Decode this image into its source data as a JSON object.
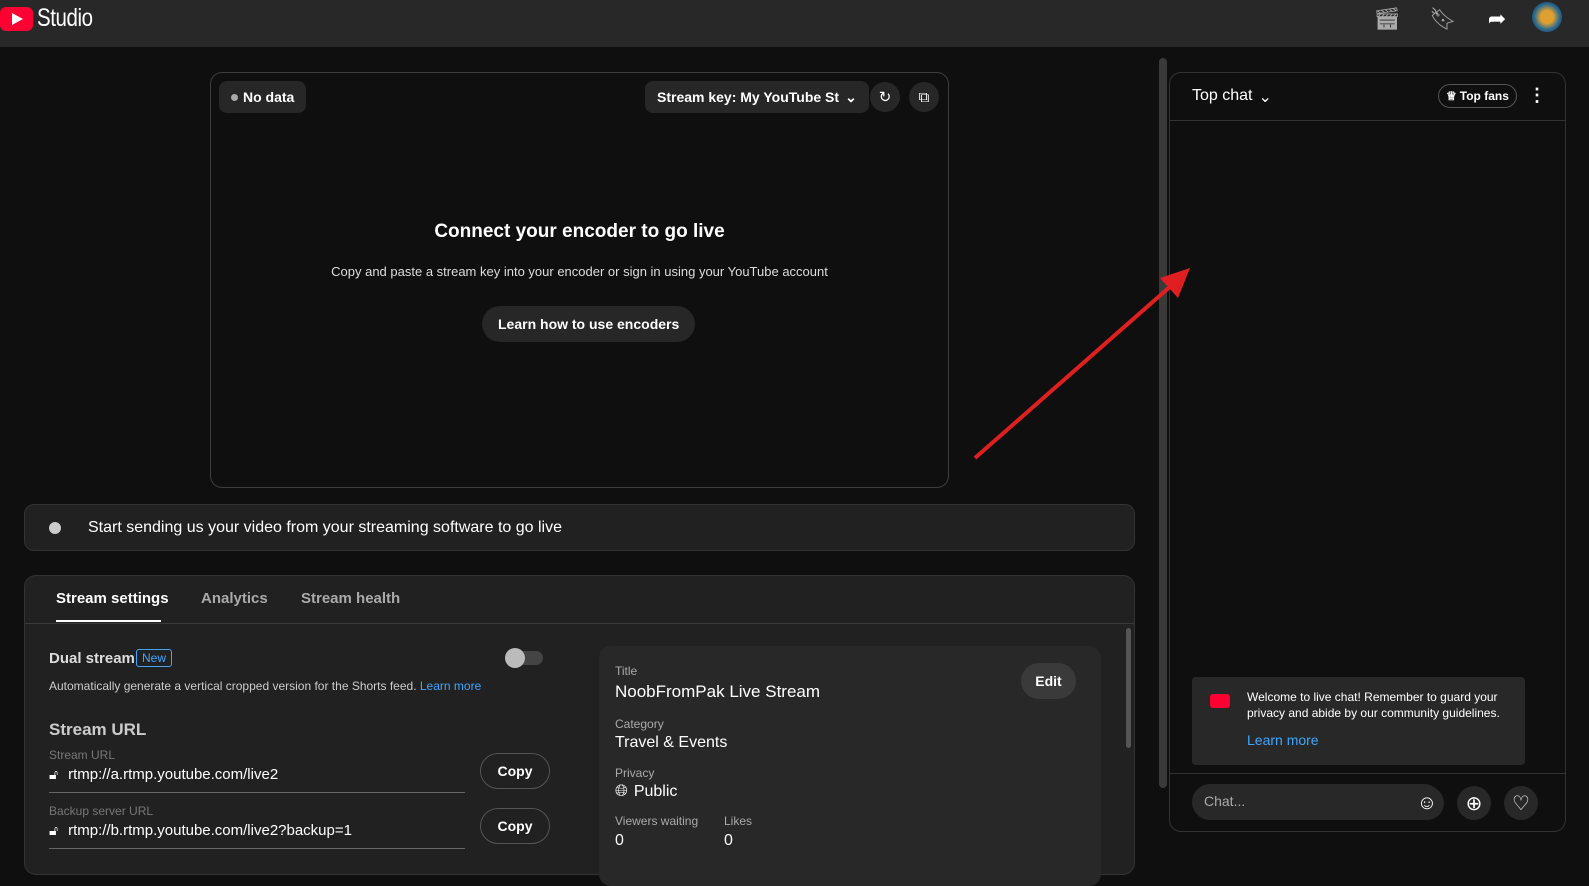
{
  "header": {
    "app_name": "Studio"
  },
  "preview": {
    "status": "No data",
    "stream_key": "Stream key: My YouTube St",
    "heading": "Connect your encoder to go live",
    "subtext": "Copy and paste a stream key into your encoder or sign in using your YouTube account",
    "learn_button": "Learn how to use encoders"
  },
  "status_bar": {
    "text": "Start sending us your video from your streaming software to go live"
  },
  "tabs": [
    "Stream settings",
    "Analytics",
    "Stream health"
  ],
  "settings": {
    "dual_stream": "Dual stream",
    "new_badge": "New",
    "dual_desc": "Automatically generate a vertical cropped version for the Shorts feed.",
    "learn_more": "Learn more",
    "stream_url_heading": "Stream URL",
    "stream_url_label": "Stream URL",
    "stream_url": "rtmp://a.rtmp.youtube.com/live2",
    "backup_label": "Backup server URL",
    "backup_url": "rtmp://b.rtmp.youtube.com/live2?backup=1",
    "copy": "Copy"
  },
  "info": {
    "title_label": "Title",
    "title": "NoobFromPak Live Stream",
    "edit": "Edit",
    "category_label": "Category",
    "category": "Travel & Events",
    "privacy_label": "Privacy",
    "privacy": "Public",
    "viewers_label": "Viewers waiting",
    "viewers": "0",
    "likes_label": "Likes",
    "likes": "0"
  },
  "chat": {
    "mode": "Top chat",
    "top_fans": "Top fans",
    "welcome": "Welcome to live chat! Remember to guard your privacy and abide by our community guidelines.",
    "learn_more": "Learn more",
    "placeholder": "Chat..."
  }
}
